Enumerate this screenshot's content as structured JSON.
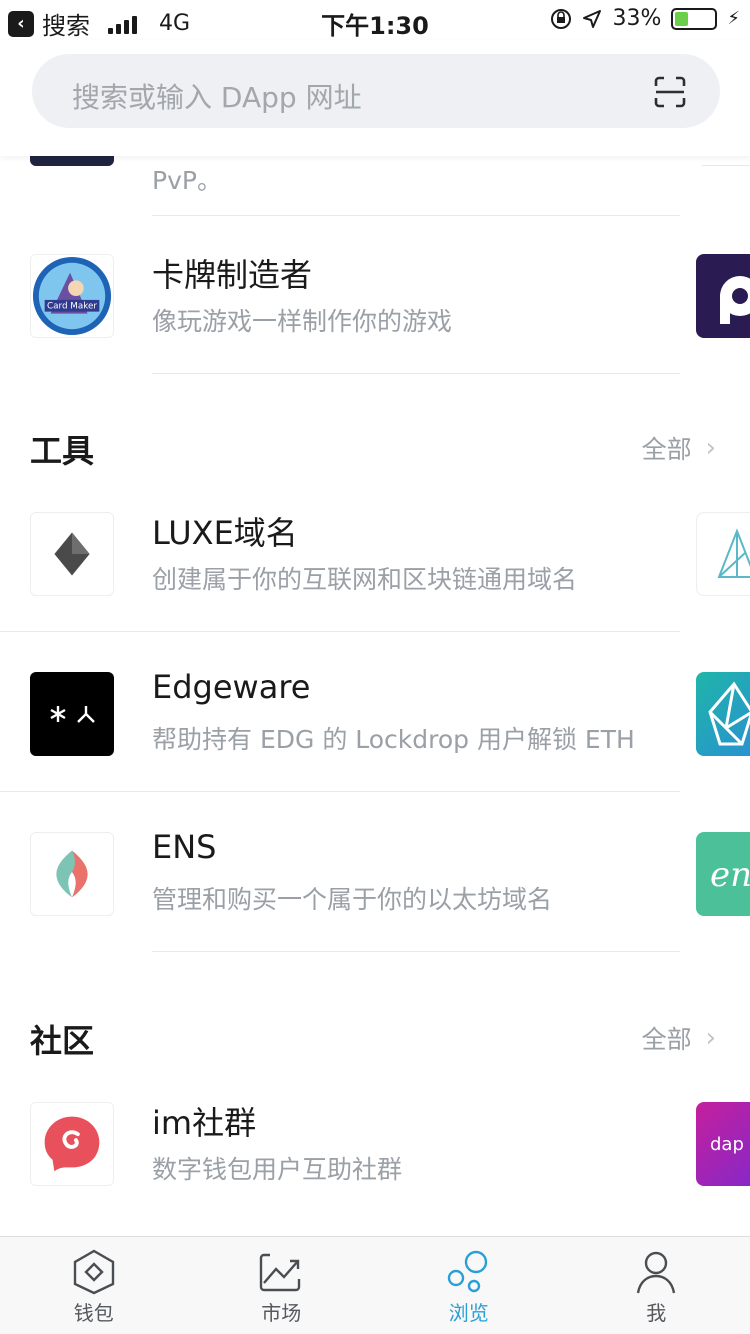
{
  "status_bar": {
    "back_label": "搜索",
    "network": "4G",
    "time": "下午1:30",
    "battery": "33%",
    "battery_level": 0.33
  },
  "search": {
    "placeholder": "搜索或输入 DApp 网址",
    "scan_icon": "scan-icon"
  },
  "partial_row": {
    "desc": "PvP。"
  },
  "games": [
    {
      "title": "卡牌制造者",
      "desc": "像玩游戏一样制作你的游戏",
      "icon": "card-maker-logo"
    }
  ],
  "sections": [
    {
      "title": "工具",
      "more": "全部",
      "items": [
        {
          "title": "LUXE域名",
          "desc": "创建属于你的互联网和区块链通用域名",
          "icon": "diamond-icon"
        },
        {
          "title": "Edgeware",
          "desc": "帮助持有 EDG 的 Lockdrop 用户解锁 ETH",
          "icon": "edgeware-icon"
        },
        {
          "title": "ENS",
          "desc": "管理和购买一个属于你的以太坊域名",
          "icon": "ens-icon"
        }
      ]
    },
    {
      "title": "社区",
      "more": "全部",
      "items": [
        {
          "title": "im社群",
          "desc": "数字钱包用户互助社群",
          "icon": "chat-bubble-icon"
        }
      ]
    }
  ],
  "tabs": [
    {
      "label": "钱包",
      "icon": "wallet-icon",
      "active": false
    },
    {
      "label": "市场",
      "icon": "market-icon",
      "active": false
    },
    {
      "label": "浏览",
      "icon": "browse-icon",
      "active": true
    },
    {
      "label": "我",
      "icon": "profile-icon",
      "active": false
    }
  ],
  "colors": {
    "accent": "#2a9fd6",
    "battery_fill": "#6ad04a"
  }
}
